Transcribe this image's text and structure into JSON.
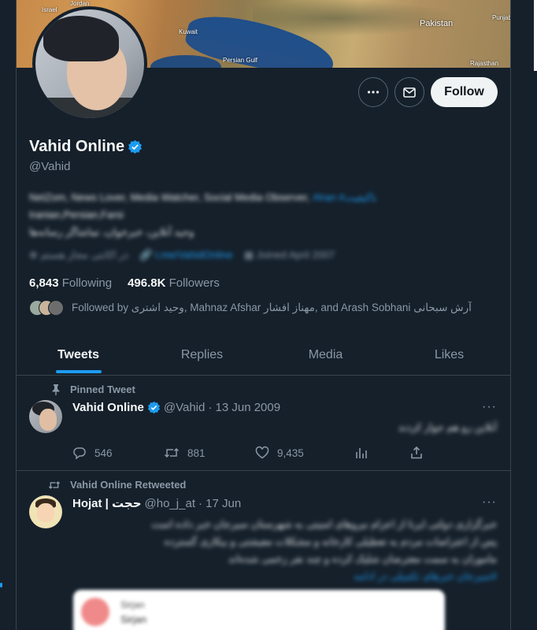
{
  "banner": {
    "labels": [
      "Israel",
      "Jordan",
      "Kuwait",
      "Persian Gulf",
      "Pakistan",
      "Punjab",
      "Rajasthan"
    ]
  },
  "profile": {
    "display_name": "Vahid Online",
    "handle": "@Vahid",
    "follow_label": "Follow",
    "bio_line1": "NetZom, News Lover, Media Watcher, Social Media Observer,",
    "bio_link": "#Iran #باکیفیت",
    "bio_line2": "Iranian,Persian,Farsi",
    "bio_line3": "وحید آنلاین، خبرخوان، تماشاگر رسانه‌ها",
    "meta_location": "در اکانتی مجاز هستم",
    "meta_link": "t.me/VahidOnline",
    "meta_joined": "Joined April 2007",
    "following_count": "6,843",
    "following_label": "Following",
    "followers_count": "496.8K",
    "followers_label": "Followers",
    "followed_by": "Followed by وحید اشتری, Mahnaz Afshar مهناز افشار, and Arash Sobhani آرش سبحانی"
  },
  "tabs": [
    {
      "label": "Tweets"
    },
    {
      "label": "Replies"
    },
    {
      "label": "Media"
    },
    {
      "label": "Likes"
    }
  ],
  "tweets": [
    {
      "context": "Pinned Tweet",
      "name": "Vahid Online",
      "handle": "@Vahid",
      "date": "· 13 Jun 2009",
      "text": "آنلاین رو هم جواز کردند",
      "replies": "546",
      "retweets": "881",
      "likes": "9,435"
    },
    {
      "context": "Vahid Online Retweeted",
      "name": "Hojat | حجت",
      "handle": "@ho_j_at",
      "date": "· 17 Jun",
      "text_line1": "خبرگزاری دولتی ایرنا از اعزام نیروهای امنیتی به شهرستان سیرجان خبر داده است",
      "text_line2": "پس از اعتراضات مردم به تعطیلی کارخانه و مشکلات معیشتی و بیکاری گسترده",
      "text_line3": "ماموران به سمت معترضان شلیک کرده و چند نفر زخمی شده‌اند",
      "text_line4": "#سیرجان خبرهای تکمیلی در ادامه",
      "quote_title": "Sirjan",
      "quote_sub": "Sirjan"
    }
  ],
  "colors": {
    "background": "#15202b",
    "accent": "#1d9bf0",
    "border": "#38444d",
    "secondary_text": "#8b98a5"
  }
}
